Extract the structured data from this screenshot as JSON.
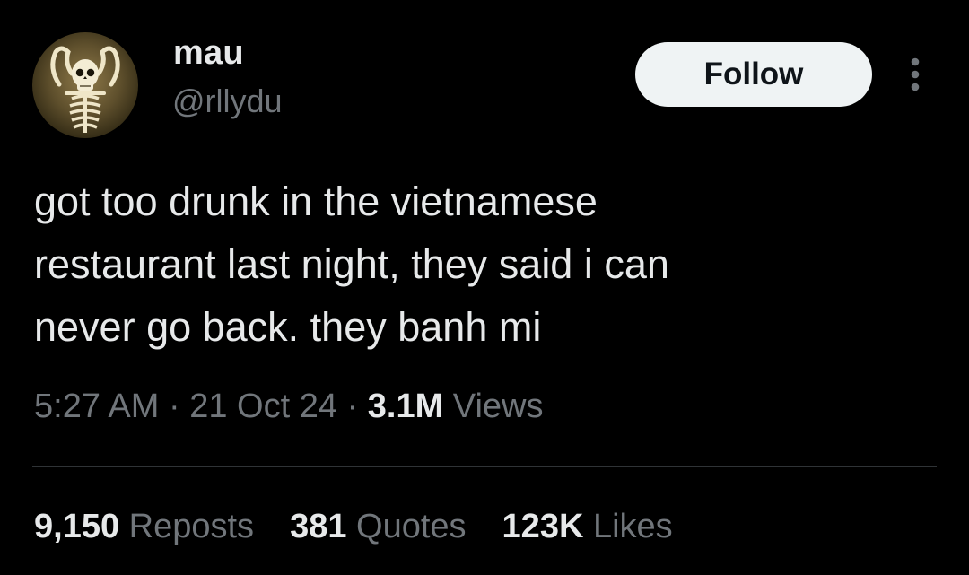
{
  "author": {
    "name": "mau",
    "handle": "@rllydu",
    "avatar_icon": "skeleton-icon"
  },
  "follow_button": {
    "label": "Follow"
  },
  "more_menu": {
    "icon": "more-vertical-icon"
  },
  "tweet": {
    "lines": [
      "got too drunk in the vietnamese",
      "restaurant last night, they said i can",
      "never go back. they banh mi"
    ]
  },
  "meta": {
    "time": "5:27 AM",
    "separator1": " · ",
    "date": "21 Oct 24",
    "separator2": " · ",
    "views_count": "3.1M",
    "views_label": " Views"
  },
  "stats": {
    "reposts": {
      "count": "9,150",
      "label": " Reposts"
    },
    "quotes": {
      "count": "381",
      "label": " Quotes"
    },
    "likes": {
      "count": "123K",
      "label": " Likes"
    }
  },
  "colors": {
    "background": "#000000",
    "primary_text": "#e7e9ea",
    "secondary_text": "#71767b",
    "follow_bg": "#eff3f4",
    "follow_text": "#0f1419",
    "divider": "#2f3336"
  }
}
